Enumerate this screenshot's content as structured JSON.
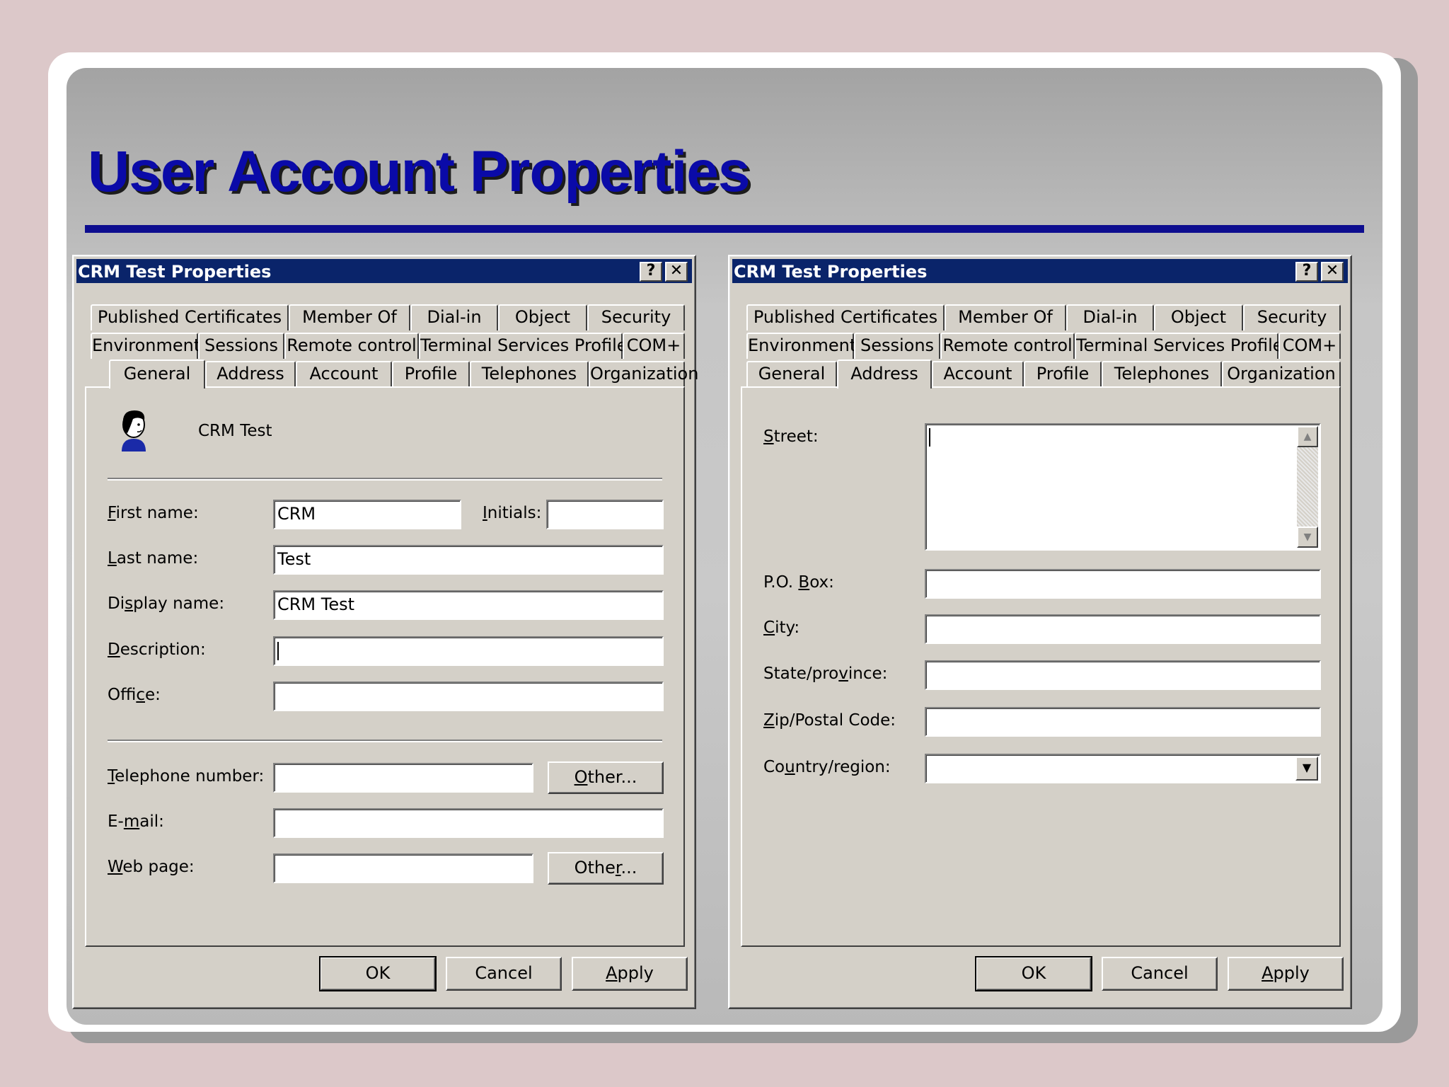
{
  "slide": {
    "title": "User Account Properties"
  },
  "dialogs": [
    {
      "title": "CRM Test Properties",
      "help_glyph": "?",
      "close_glyph": "✕",
      "tabs_row1": [
        "Published Certificates",
        "Member Of",
        "Dial-in",
        "Object",
        "Security"
      ],
      "tabs_row2": [
        "Environment",
        "Sessions",
        "Remote control",
        "Terminal Services Profile",
        "COM+"
      ],
      "tabs_row3": [
        "General",
        "Address",
        "Account",
        "Profile",
        "Telephones",
        "Organization"
      ],
      "active_tab": "General",
      "user_display": "CRM Test",
      "fields": {
        "first_name": {
          "label_pre": "",
          "label_u": "F",
          "label_post": "irst name:",
          "value": "CRM"
        },
        "initials": {
          "label_pre": "",
          "label_u": "I",
          "label_post": "nitials:",
          "value": ""
        },
        "last_name": {
          "label_pre": "",
          "label_u": "L",
          "label_post": "ast name:",
          "value": "Test"
        },
        "display_name": {
          "label_pre": "Di",
          "label_u": "s",
          "label_post": "play name:",
          "value": "CRM Test"
        },
        "description": {
          "label_pre": "",
          "label_u": "D",
          "label_post": "escription:",
          "value": ""
        },
        "office": {
          "label_pre": "Offi",
          "label_u": "c",
          "label_post": "e:",
          "value": ""
        },
        "telephone": {
          "label_pre": "",
          "label_u": "T",
          "label_post": "elephone number:",
          "value": ""
        },
        "email": {
          "label_pre": "E-",
          "label_u": "m",
          "label_post": "ail:",
          "value": ""
        },
        "web_page": {
          "label_pre": "",
          "label_u": "W",
          "label_post": "eb page:",
          "value": ""
        }
      },
      "other_phone": {
        "pre": "",
        "u": "O",
        "post": "ther..."
      },
      "other_web": {
        "pre": "Othe",
        "u": "r",
        "post": "..."
      },
      "buttons": {
        "ok": "OK",
        "cancel": "Cancel",
        "apply_u": "A",
        "apply_post": "pply"
      }
    },
    {
      "title": "CRM Test Properties",
      "help_glyph": "?",
      "close_glyph": "✕",
      "tabs_row1": [
        "Published Certificates",
        "Member Of",
        "Dial-in",
        "Object",
        "Security"
      ],
      "tabs_row2": [
        "Environment",
        "Sessions",
        "Remote control",
        "Terminal Services Profile",
        "COM+"
      ],
      "tabs_row3": [
        "General",
        "Address",
        "Account",
        "Profile",
        "Telephones",
        "Organization"
      ],
      "active_tab": "Address",
      "fields": {
        "street": {
          "label_pre": "",
          "label_u": "S",
          "label_post": "treet:",
          "value": ""
        },
        "po_box": {
          "label_pre": "P.O. ",
          "label_u": "B",
          "label_post": "ox:",
          "value": ""
        },
        "city": {
          "label_pre": "",
          "label_u": "C",
          "label_post": "ity:",
          "value": ""
        },
        "state": {
          "label_pre": "State/pro",
          "label_u": "v",
          "label_post": "ince:",
          "value": ""
        },
        "zip": {
          "label_pre": "",
          "label_u": "Z",
          "label_post": "ip/Postal Code:",
          "value": ""
        },
        "country": {
          "label_pre": "Co",
          "label_u": "u",
          "label_post": "ntry/region:",
          "value": ""
        }
      },
      "scroll_up_glyph": "▲",
      "scroll_down_glyph": "▼",
      "dropdown_glyph": "▼",
      "buttons": {
        "ok": "OK",
        "cancel": "Cancel",
        "apply_u": "A",
        "apply_post": "pply"
      }
    }
  ]
}
